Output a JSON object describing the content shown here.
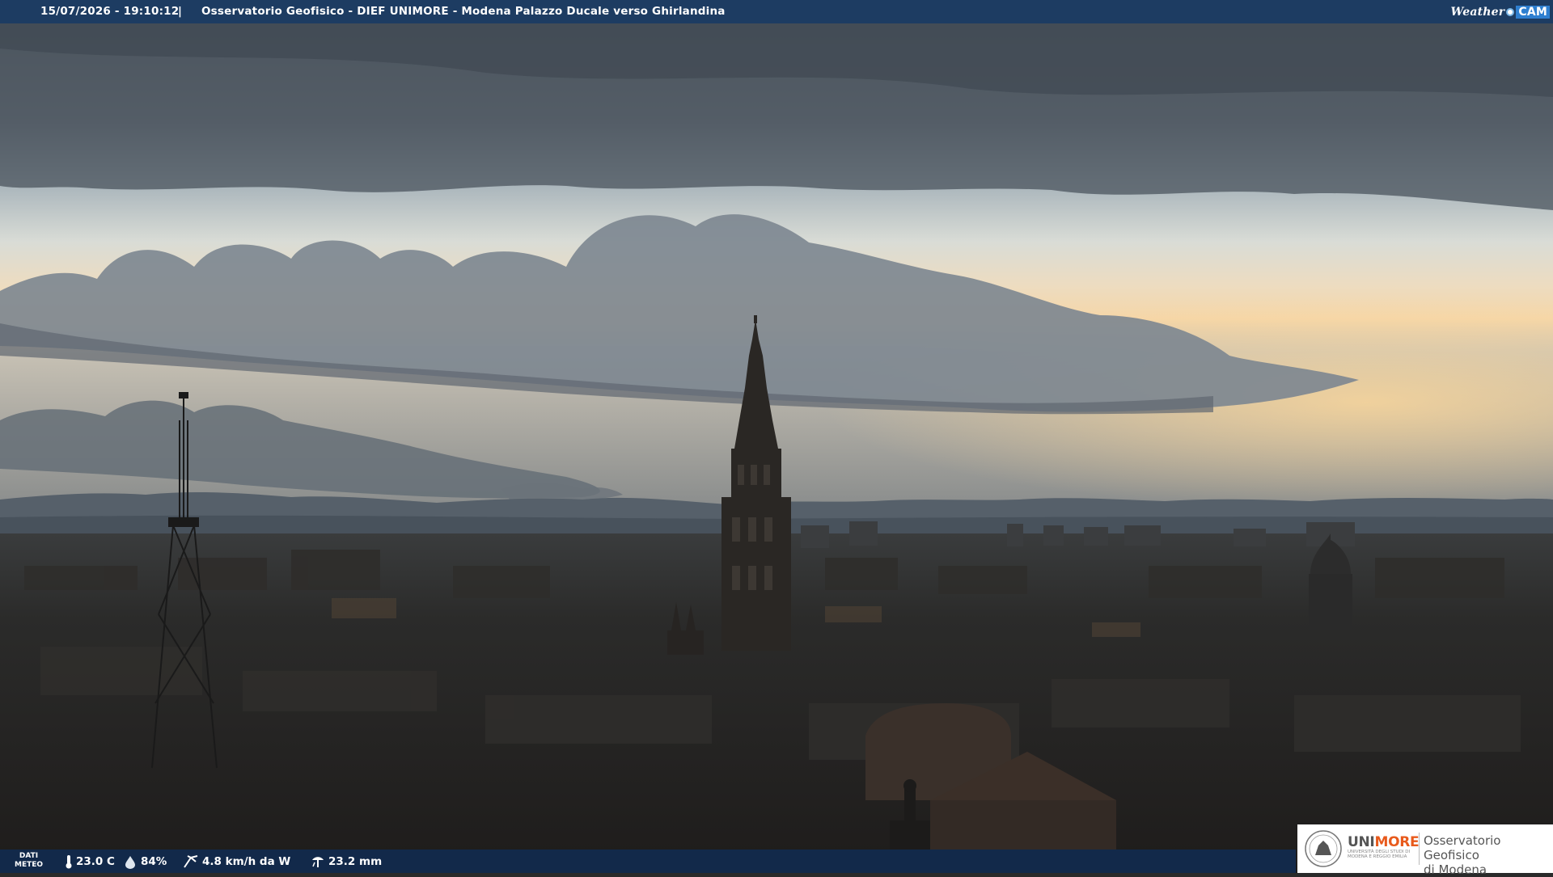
{
  "header": {
    "timestamp": "15/07/2026 - 19:10:12",
    "separator": "|",
    "title": "Osservatorio Geofisico - DIEF UNIMORE - Modena Palazzo Ducale verso Ghirlandina",
    "logo_weather": "Weather",
    "logo_cam": "CAM"
  },
  "footer": {
    "dati_line1": "DATI",
    "dati_line2": "METEO",
    "temperature": "23.0 C",
    "humidity": "84%",
    "wind": "4.8 km/h da W",
    "rain": "23.2 mm",
    "icons": [
      "thermometer-icon",
      "humidity-drop-icon",
      "wind-icon",
      "rain-gauge-icon"
    ]
  },
  "unimore_logo": {
    "brand_uni": "UNI",
    "brand_more": "MORE",
    "subtitle": "UNIVERSITÀ DEGLI STUDI DI MODENA E REGGIO EMILIA",
    "observatory_line1": "Osservatorio Geofisico",
    "observatory_line2": "di Modena"
  },
  "colors": {
    "header_bar": "#1d3c62",
    "footer_bar": "#12294a",
    "unimore_orange": "#e85a1c",
    "sky_top": "#4a535d",
    "sky_horizon": "#f5d6a8"
  }
}
